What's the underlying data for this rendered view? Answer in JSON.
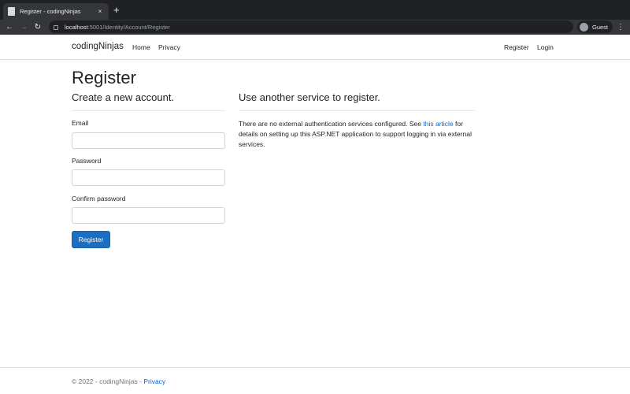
{
  "browser": {
    "tab_title": "Register - codingNinjas",
    "tab_close": "×",
    "new_tab": "+",
    "back": "←",
    "forward": "→",
    "reload": "↻",
    "url_host": "localhost",
    "url_path": ":5001/Identity/Account/Register",
    "profile_label": "Guest",
    "menu": "⋮"
  },
  "navbar": {
    "brand": "codingNinjas",
    "links": [
      "Home",
      "Privacy"
    ],
    "right_links": [
      "Register",
      "Login"
    ]
  },
  "page": {
    "title": "Register",
    "form": {
      "heading": "Create a new account.",
      "email_label": "Email",
      "email_value": "",
      "password_label": "Password",
      "password_value": "",
      "confirm_label": "Confirm password",
      "confirm_value": "",
      "submit_label": "Register"
    },
    "external": {
      "heading": "Use another service to register.",
      "text_before": "There are no external authentication services configured. See ",
      "link_text": "this article",
      "text_after": " for details on setting up this ASP.NET application to support logging in via external services."
    }
  },
  "footer": {
    "text": "© 2022 - codingNinjas - ",
    "link": "Privacy"
  },
  "colors": {
    "accent": "#1b6ec2",
    "link": "#0366d6"
  }
}
